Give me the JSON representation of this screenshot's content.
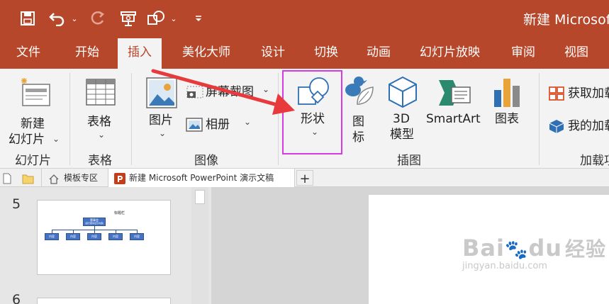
{
  "window": {
    "title": "新建 Microsoft"
  },
  "tabs": [
    {
      "label": "文件"
    },
    {
      "label": "开始"
    },
    {
      "label": "插入"
    },
    {
      "label": "美化大师"
    },
    {
      "label": "设计"
    },
    {
      "label": "切换"
    },
    {
      "label": "动画"
    },
    {
      "label": "幻灯片放映"
    },
    {
      "label": "审阅"
    },
    {
      "label": "视图"
    }
  ],
  "ribbon": {
    "new_slide": {
      "line1": "新建",
      "line2": "幻灯片"
    },
    "table": {
      "label": "表格"
    },
    "picture": {
      "label": "图片"
    },
    "screenshot": {
      "label": "屏幕截图"
    },
    "album": {
      "label": "相册"
    },
    "shapes": {
      "label": "形状"
    },
    "icons": {
      "line1": "图",
      "line2": "标"
    },
    "model3d": {
      "line1": "3D",
      "line2": "模型"
    },
    "smartart": {
      "label": "SmartArt"
    },
    "chart": {
      "label": "图表"
    },
    "get_addins": {
      "label": "获取加载"
    },
    "my_addins": {
      "label": "我的加载"
    },
    "groups": {
      "slides": "幻灯片",
      "tables": "表格",
      "images": "图像",
      "illustrations": "插图",
      "addins": "加载项"
    }
  },
  "doc_tabs": {
    "template_zone": "模板专区",
    "active_doc": "新建 Microsoft PowerPoint 演示文稿",
    "add": "+"
  },
  "slides": [
    {
      "number": "5",
      "title": "标题栏",
      "top_box": "董事会",
      "top_box_sub": "(首行居中显示内容)",
      "child_label": "内容"
    },
    {
      "number": "6"
    }
  ],
  "watermark": {
    "brand": "Bai",
    "brand2": "du",
    "text": "经验",
    "url": "jingyan.baidu.com"
  },
  "colors": {
    "accent": "#b7472a",
    "highlight_box": "#d63ae0",
    "arrow": "#e8393d"
  }
}
